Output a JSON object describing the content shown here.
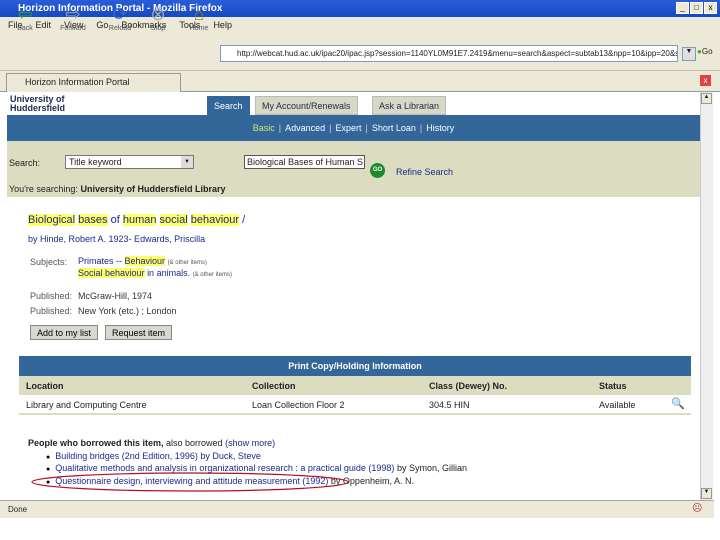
{
  "window": {
    "title": "Horizon Information Portal - Mozilla Firefox",
    "min": "_",
    "max": "□",
    "close": "x"
  },
  "menu": [
    "File",
    "Edit",
    "View",
    "Go",
    "Bookmarks",
    "Tools",
    "Help"
  ],
  "toolbar": {
    "back": "Back",
    "forward": "Forward",
    "reload": "Reload",
    "stop": "Stop",
    "home": "Home",
    "url": "http://webcat.hud.ac.uk/ipac20/ipac.jsp?session=1140YL0M91E7.2419&menu=search&aspect=subtab13&npp=10&ipp=20&s",
    "go": "Go"
  },
  "browser_tab": "Horizon Information Portal",
  "logo": {
    "line1": "University of",
    "line2": "Huddersfield"
  },
  "page_tabs": [
    "Search",
    "My Account/Renewals",
    "Ask a Librarian"
  ],
  "subnav": [
    "Basic",
    "Advanced",
    "Expert",
    "Short Loan",
    "History"
  ],
  "search": {
    "label": "Search:",
    "field": "Title keyword",
    "query": "Biological Bases of Human S",
    "go": "GO",
    "refine": "Refine Search",
    "searching_prefix": "You're searching:",
    "searching_lib": "University of Huddersfield Library"
  },
  "record": {
    "title_words": [
      "Biological",
      "bases",
      "of",
      "human",
      "social",
      "behaviour",
      "/"
    ],
    "author": "by Hinde, Robert A. 1923- Edwards, Priscilla",
    "subjects_label": "Subjects:",
    "subject1a": "Primates",
    "subject1b": "Behaviour",
    "subject1_note": "(& other items)",
    "subject2a": "Social behaviour",
    "subject2b": "in animals.",
    "subject2_note": "(& other items)",
    "published_label": "Published:",
    "published": "McGraw-Hill, 1974",
    "pubplace_label": "Published:",
    "pubplace": "New York (etc.) ; London",
    "add_btn": "Add to my list",
    "request_btn": "Request item"
  },
  "holdings": {
    "header": "Print Copy/Holding Information",
    "cols": [
      "Location",
      "Collection",
      "Class (Dewey) No.",
      "Status"
    ],
    "row": [
      "Library and Computing Centre",
      "Loan Collection Floor 2",
      "304.5 HIN",
      "Available"
    ]
  },
  "also": {
    "prefix": "People who borrowed this item,",
    "mid": "also borrowed",
    "more": "(show more)",
    "items": [
      {
        "title": "Building bridges (2nd Edition, 1996) by Duck, Steve",
        "by": ""
      },
      {
        "title": "Qualitative methods and analysis in organizational research : a practical guide (1998)",
        "by": "by Symon, Gillian"
      },
      {
        "title": "Questionnaire design, interviewing and attitude measurement (1992)",
        "by": "by Oppenheim, A. N."
      }
    ]
  },
  "status": "Done",
  "colors": {
    "nav": "#336699",
    "panel": "#dcdcc0",
    "highlight": "#ffff66",
    "annotation": "#b01020"
  }
}
